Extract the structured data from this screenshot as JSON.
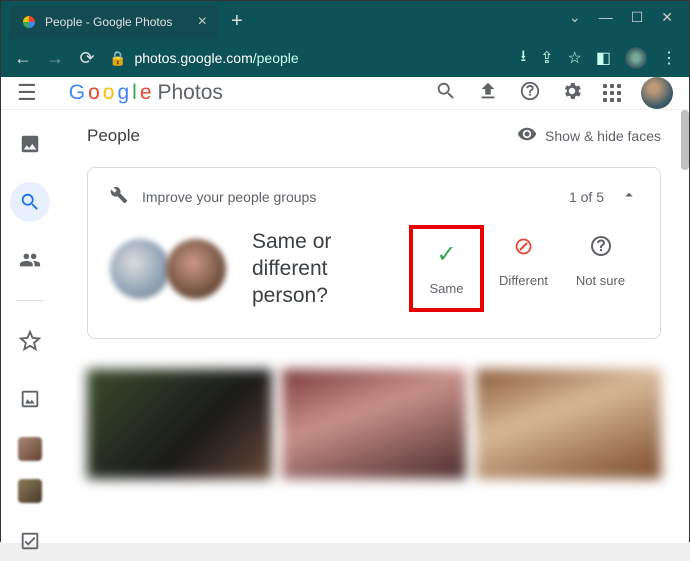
{
  "browser": {
    "tab_title": "People - Google Photos",
    "url_domain": "photos.google.com",
    "url_path": "/people"
  },
  "app": {
    "logo_suffix": "Photos"
  },
  "page": {
    "title": "People",
    "show_hide_label": "Show & hide faces"
  },
  "card": {
    "heading": "Improve your people groups",
    "counter": "1 of 5",
    "prompt": "Same or different person?",
    "actions": {
      "same": "Same",
      "different": "Different",
      "notsure": "Not sure"
    }
  }
}
